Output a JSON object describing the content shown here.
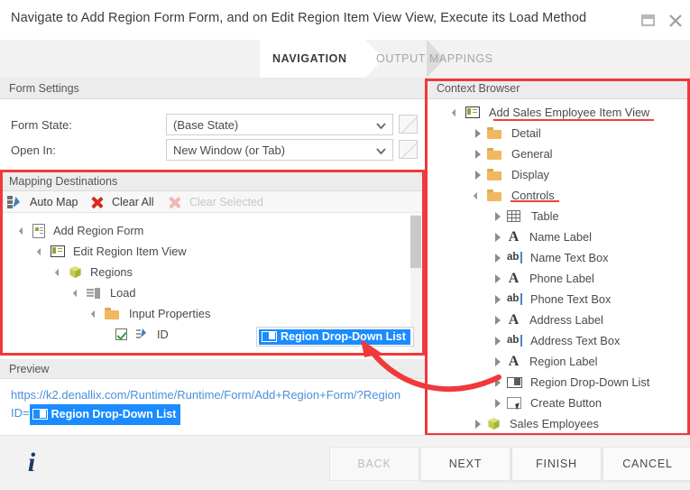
{
  "window": {
    "title": "Navigate to Add Region Form Form, and on Edit Region Item View View, Execute its Load Method",
    "restore_icon": "restore-window-icon",
    "close_icon": "close-icon"
  },
  "tabs": [
    {
      "label": "NAVIGATION",
      "active": true
    },
    {
      "label": "OUTPUT MAPPINGS",
      "active": false
    }
  ],
  "form_settings": {
    "header": "Form Settings",
    "fields": [
      {
        "label": "Form State:",
        "value": "(Base State)"
      },
      {
        "label": "Open In:",
        "value": "New Window (or Tab)"
      }
    ]
  },
  "mapping": {
    "header": "Mapping Destinations",
    "toolbar": [
      {
        "label": "Auto Map",
        "icon": "auto-map-icon",
        "disabled": false,
        "underlined": true
      },
      {
        "label": "Clear All",
        "icon": "clear-all-icon",
        "disabled": false,
        "underlined": false
      },
      {
        "label": "Clear Selected",
        "icon": "clear-selected-icon",
        "disabled": true,
        "underlined": false
      }
    ],
    "tree": [
      {
        "label": "Add Region Form",
        "icon": "form-icon",
        "indent": 0,
        "twisty": "expanded"
      },
      {
        "label": "Edit Region Item View",
        "icon": "item-view-icon",
        "indent": 1,
        "twisty": "expanded"
      },
      {
        "label": "Regions",
        "icon": "smartobject-icon",
        "indent": 2,
        "twisty": "expanded"
      },
      {
        "label": "Load",
        "icon": "method-icon",
        "indent": 3,
        "twisty": "expanded"
      },
      {
        "label": "Input Properties",
        "icon": "folder-icon",
        "indent": 4,
        "twisty": "expanded"
      },
      {
        "label": "ID",
        "icon": "property-icon",
        "indent": 5,
        "twisty": "none",
        "checked": true
      }
    ],
    "mapped_value": "Region Drop-Down List"
  },
  "preview": {
    "header": "Preview",
    "url_part1": "https://k2.denallix.com/Runtime/Runtime/Form/Add+Region+Form/?Region",
    "url_part2": "ID=",
    "token": "Region Drop-Down List"
  },
  "context_browser": {
    "header": "Context Browser",
    "tree": [
      {
        "label": "Add Sales Employee Item View",
        "icon": "item-view-icon",
        "indent": 0,
        "twisty": "expanded",
        "underlined": true
      },
      {
        "label": "Detail",
        "icon": "folder-icon",
        "indent": 1,
        "twisty": "collapsed"
      },
      {
        "label": "General",
        "icon": "folder-icon",
        "indent": 1,
        "twisty": "collapsed"
      },
      {
        "label": "Display",
        "icon": "folder-icon",
        "indent": 1,
        "twisty": "collapsed"
      },
      {
        "label": "Controls",
        "icon": "folder-icon",
        "indent": 1,
        "twisty": "expanded",
        "underlined": true
      },
      {
        "label": "Table",
        "icon": "table-icon",
        "indent": 2,
        "twisty": "collapsed"
      },
      {
        "label": "Name Label",
        "icon": "label-icon",
        "indent": 2,
        "twisty": "collapsed"
      },
      {
        "label": "Name Text Box",
        "icon": "textbox-icon",
        "indent": 2,
        "twisty": "collapsed"
      },
      {
        "label": "Phone Label",
        "icon": "label-icon",
        "indent": 2,
        "twisty": "collapsed"
      },
      {
        "label": "Phone Text Box",
        "icon": "textbox-icon",
        "indent": 2,
        "twisty": "collapsed"
      },
      {
        "label": "Address Label",
        "icon": "label-icon",
        "indent": 2,
        "twisty": "collapsed"
      },
      {
        "label": "Address Text Box",
        "icon": "textbox-icon",
        "indent": 2,
        "twisty": "collapsed"
      },
      {
        "label": "Region Label",
        "icon": "label-icon",
        "indent": 2,
        "twisty": "collapsed"
      },
      {
        "label": "Region Drop-Down List",
        "icon": "dropdown-icon",
        "indent": 2,
        "twisty": "collapsed"
      },
      {
        "label": "Create Button",
        "icon": "button-icon",
        "indent": 2,
        "twisty": "collapsed"
      },
      {
        "label": "Sales Employees",
        "icon": "smartobject-icon",
        "indent": 1,
        "twisty": "collapsed"
      }
    ]
  },
  "footer": {
    "info_icon": "info-icon",
    "buttons": [
      {
        "label": "BACK",
        "disabled": true
      },
      {
        "label": "NEXT",
        "disabled": false
      },
      {
        "label": "FINISH",
        "disabled": false
      },
      {
        "label": "CANCEL",
        "disabled": false
      }
    ]
  },
  "annotations": {
    "highlight_color": "#f0393b",
    "accent_chip_color": "#1a8cff",
    "link_color": "#4a90d9"
  }
}
